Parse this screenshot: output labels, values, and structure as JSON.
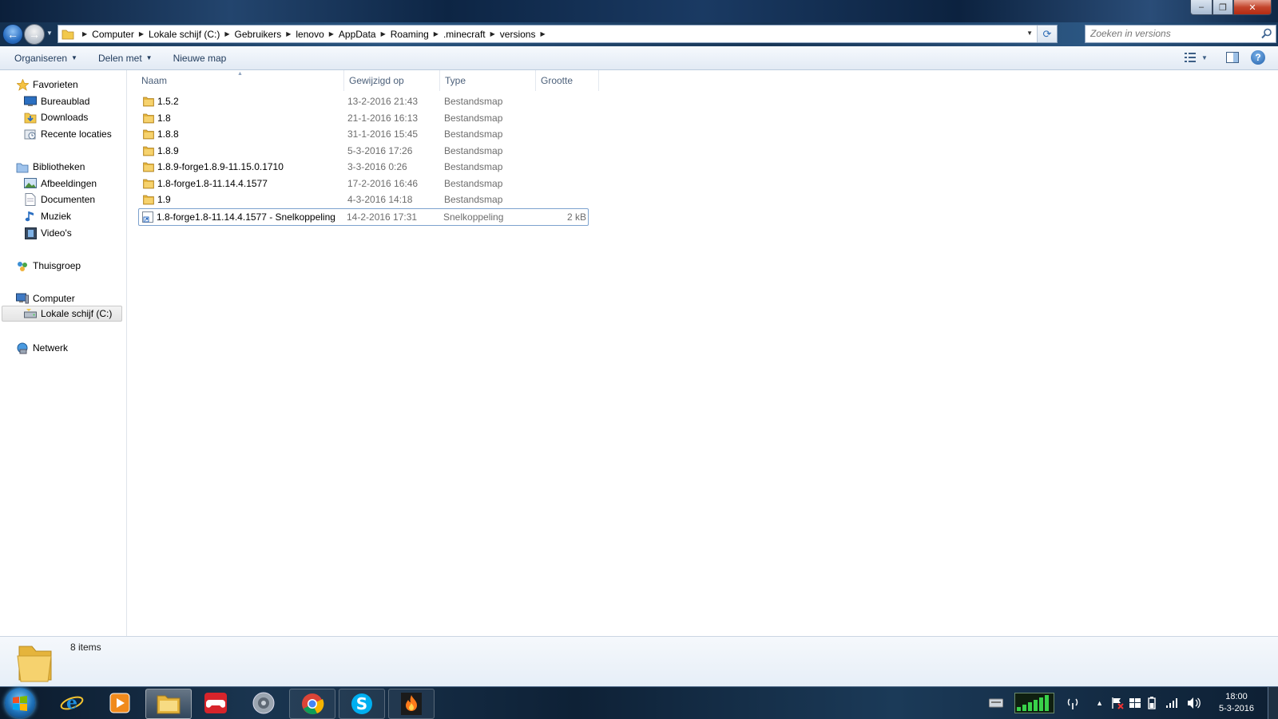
{
  "window": {
    "controls": {
      "minimize": "–",
      "maximize": "❐",
      "close": "✕"
    }
  },
  "nav": {
    "back_label": "←",
    "forward_label": "→",
    "breadcrumb": [
      "Computer",
      "Lokale schijf (C:)",
      "Gebruikers",
      "lenovo",
      "AppData",
      "Roaming",
      ".minecraft",
      "versions"
    ],
    "search_placeholder": "Zoeken in versions"
  },
  "toolbar": {
    "organize": "Organiseren",
    "share": "Delen met",
    "new_folder": "Nieuwe map"
  },
  "sidebar": {
    "favorites": "Favorieten",
    "desktop": "Bureaublad",
    "downloads": "Downloads",
    "recent": "Recente locaties",
    "libraries": "Bibliotheken",
    "pictures": "Afbeeldingen",
    "documents": "Documenten",
    "music": "Muziek",
    "videos": "Video's",
    "homegroup": "Thuisgroep",
    "computer": "Computer",
    "local_disk": "Lokale schijf (C:)",
    "network": "Netwerk"
  },
  "columns": {
    "name": "Naam",
    "modified": "Gewijzigd op",
    "type": "Type",
    "size": "Grootte"
  },
  "files": [
    {
      "name": "1.5.2",
      "modified": "13-2-2016 21:43",
      "type": "Bestandsmap",
      "size": ""
    },
    {
      "name": "1.8",
      "modified": "21-1-2016 16:13",
      "type": "Bestandsmap",
      "size": ""
    },
    {
      "name": "1.8.8",
      "modified": "31-1-2016 15:45",
      "type": "Bestandsmap",
      "size": ""
    },
    {
      "name": "1.8.9",
      "modified": "5-3-2016 17:26",
      "type": "Bestandsmap",
      "size": ""
    },
    {
      "name": "1.8.9-forge1.8.9-11.15.0.1710",
      "modified": "3-3-2016 0:26",
      "type": "Bestandsmap",
      "size": ""
    },
    {
      "name": "1.8-forge1.8-11.14.4.1577",
      "modified": "17-2-2016 16:46",
      "type": "Bestandsmap",
      "size": ""
    },
    {
      "name": "1.9",
      "modified": "4-3-2016 14:18",
      "type": "Bestandsmap",
      "size": ""
    },
    {
      "name": "1.8-forge1.8-11.14.4.1577 - Snelkoppeling",
      "modified": "14-2-2016 17:31",
      "type": "Snelkoppeling",
      "size": "2 kB"
    }
  ],
  "status": {
    "count": "8 items"
  },
  "taskbar": {
    "time": "18:00",
    "date": "5-3-2016"
  },
  "colors": {
    "folder": "#f2c94c",
    "accent": "#1d6fb7",
    "selection_border": "#7da2ce"
  }
}
